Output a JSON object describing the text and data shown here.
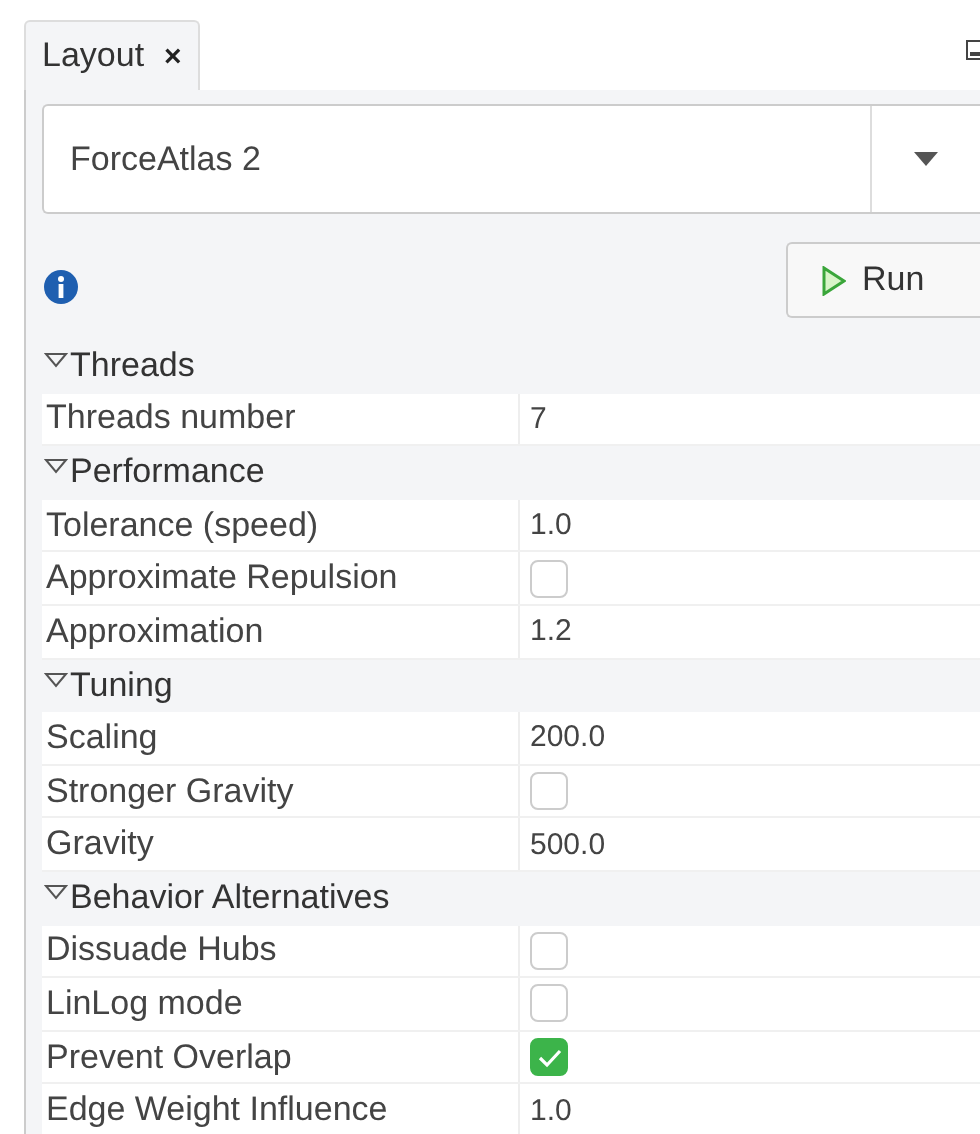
{
  "tab": {
    "title": "Layout",
    "close": "×"
  },
  "algorithm": {
    "value": "ForceAtlas 2"
  },
  "run_button": {
    "label": "Run"
  },
  "sections": [
    {
      "title": "Threads",
      "expanded": true,
      "properties": [
        {
          "kind": "text",
          "name": "Threads number",
          "value": "7"
        }
      ]
    },
    {
      "title": "Performance",
      "expanded": true,
      "properties": [
        {
          "kind": "text",
          "name": "Tolerance (speed)",
          "value": "1.0"
        },
        {
          "kind": "checkbox",
          "name": "Approximate Repulsion",
          "checked": false
        },
        {
          "kind": "text",
          "name": "Approximation",
          "value": "1.2"
        }
      ]
    },
    {
      "title": "Tuning",
      "expanded": true,
      "properties": [
        {
          "kind": "text",
          "name": "Scaling",
          "value": "200.0"
        },
        {
          "kind": "checkbox",
          "name": "Stronger Gravity",
          "checked": false
        },
        {
          "kind": "text",
          "name": "Gravity",
          "value": "500.0"
        }
      ]
    },
    {
      "title": "Behavior Alternatives",
      "expanded": true,
      "properties": [
        {
          "kind": "checkbox",
          "name": "Dissuade Hubs",
          "checked": false
        },
        {
          "kind": "checkbox",
          "name": "LinLog mode",
          "checked": false
        },
        {
          "kind": "checkbox",
          "name": "Prevent Overlap",
          "checked": true
        },
        {
          "kind": "text",
          "name": "Edge Weight Influence",
          "value": "1.0"
        }
      ]
    }
  ]
}
